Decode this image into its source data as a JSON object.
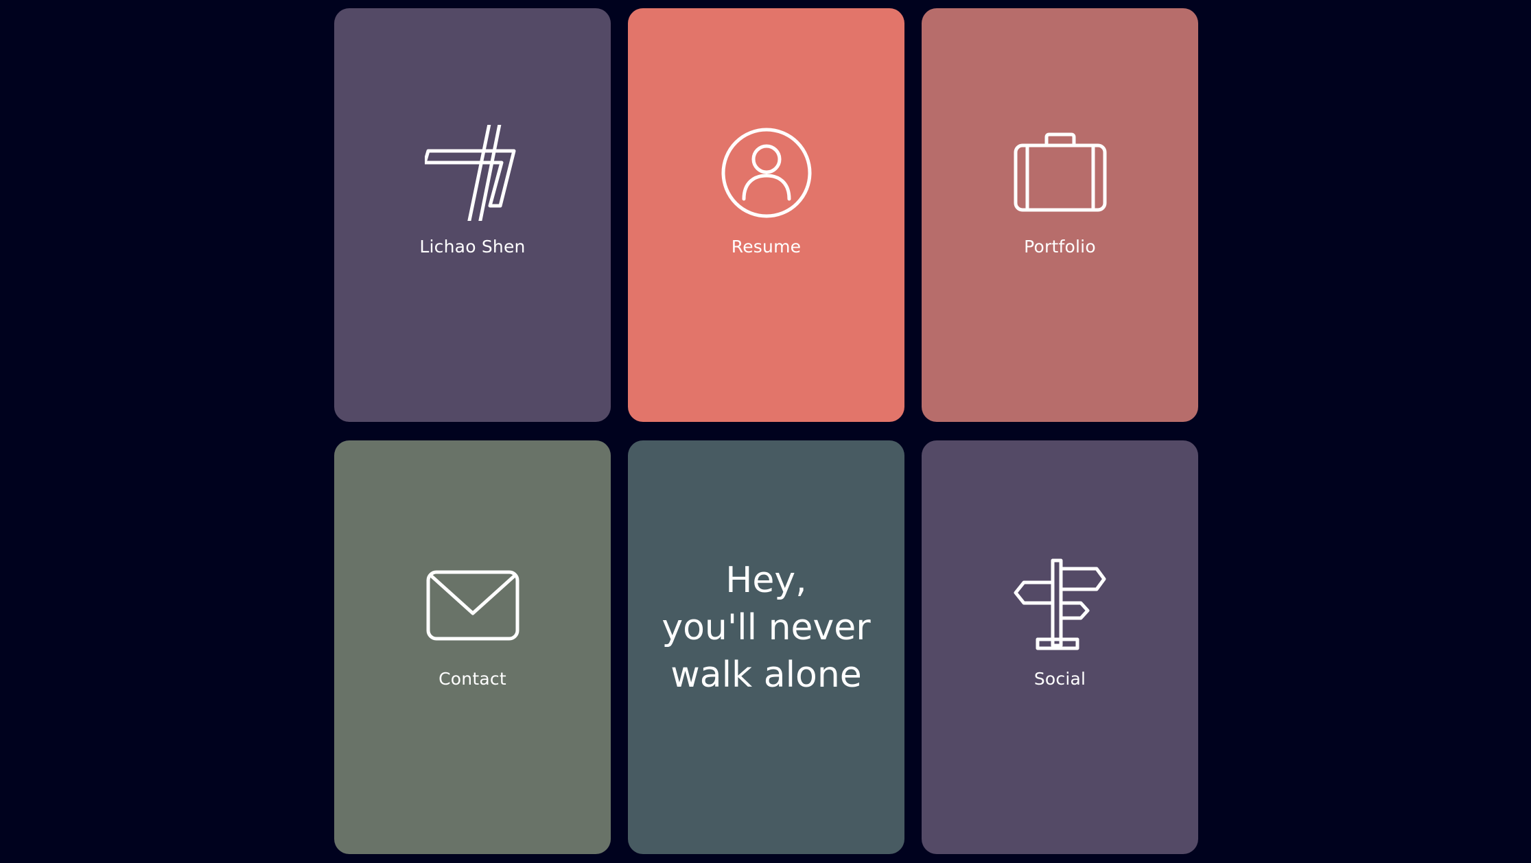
{
  "colors": {
    "background": "#00021e",
    "purple": "#544a66",
    "coral": "#e2756a",
    "rose": "#b76d6b",
    "sage": "#697368",
    "slate": "#485b62",
    "icon_stroke": "#ffffff"
  },
  "tiles": [
    {
      "label": "Lichao Shen",
      "icon": "logo-icon"
    },
    {
      "label": "Resume",
      "icon": "user-circle-icon"
    },
    {
      "label": "Portfolio",
      "icon": "briefcase-icon"
    },
    {
      "label": "Contact",
      "icon": "envelope-icon"
    },
    {
      "label": "Social",
      "icon": "signpost-icon"
    }
  ],
  "quote": {
    "line1": "Hey,",
    "line2": "you'll never",
    "line3": "walk alone"
  }
}
